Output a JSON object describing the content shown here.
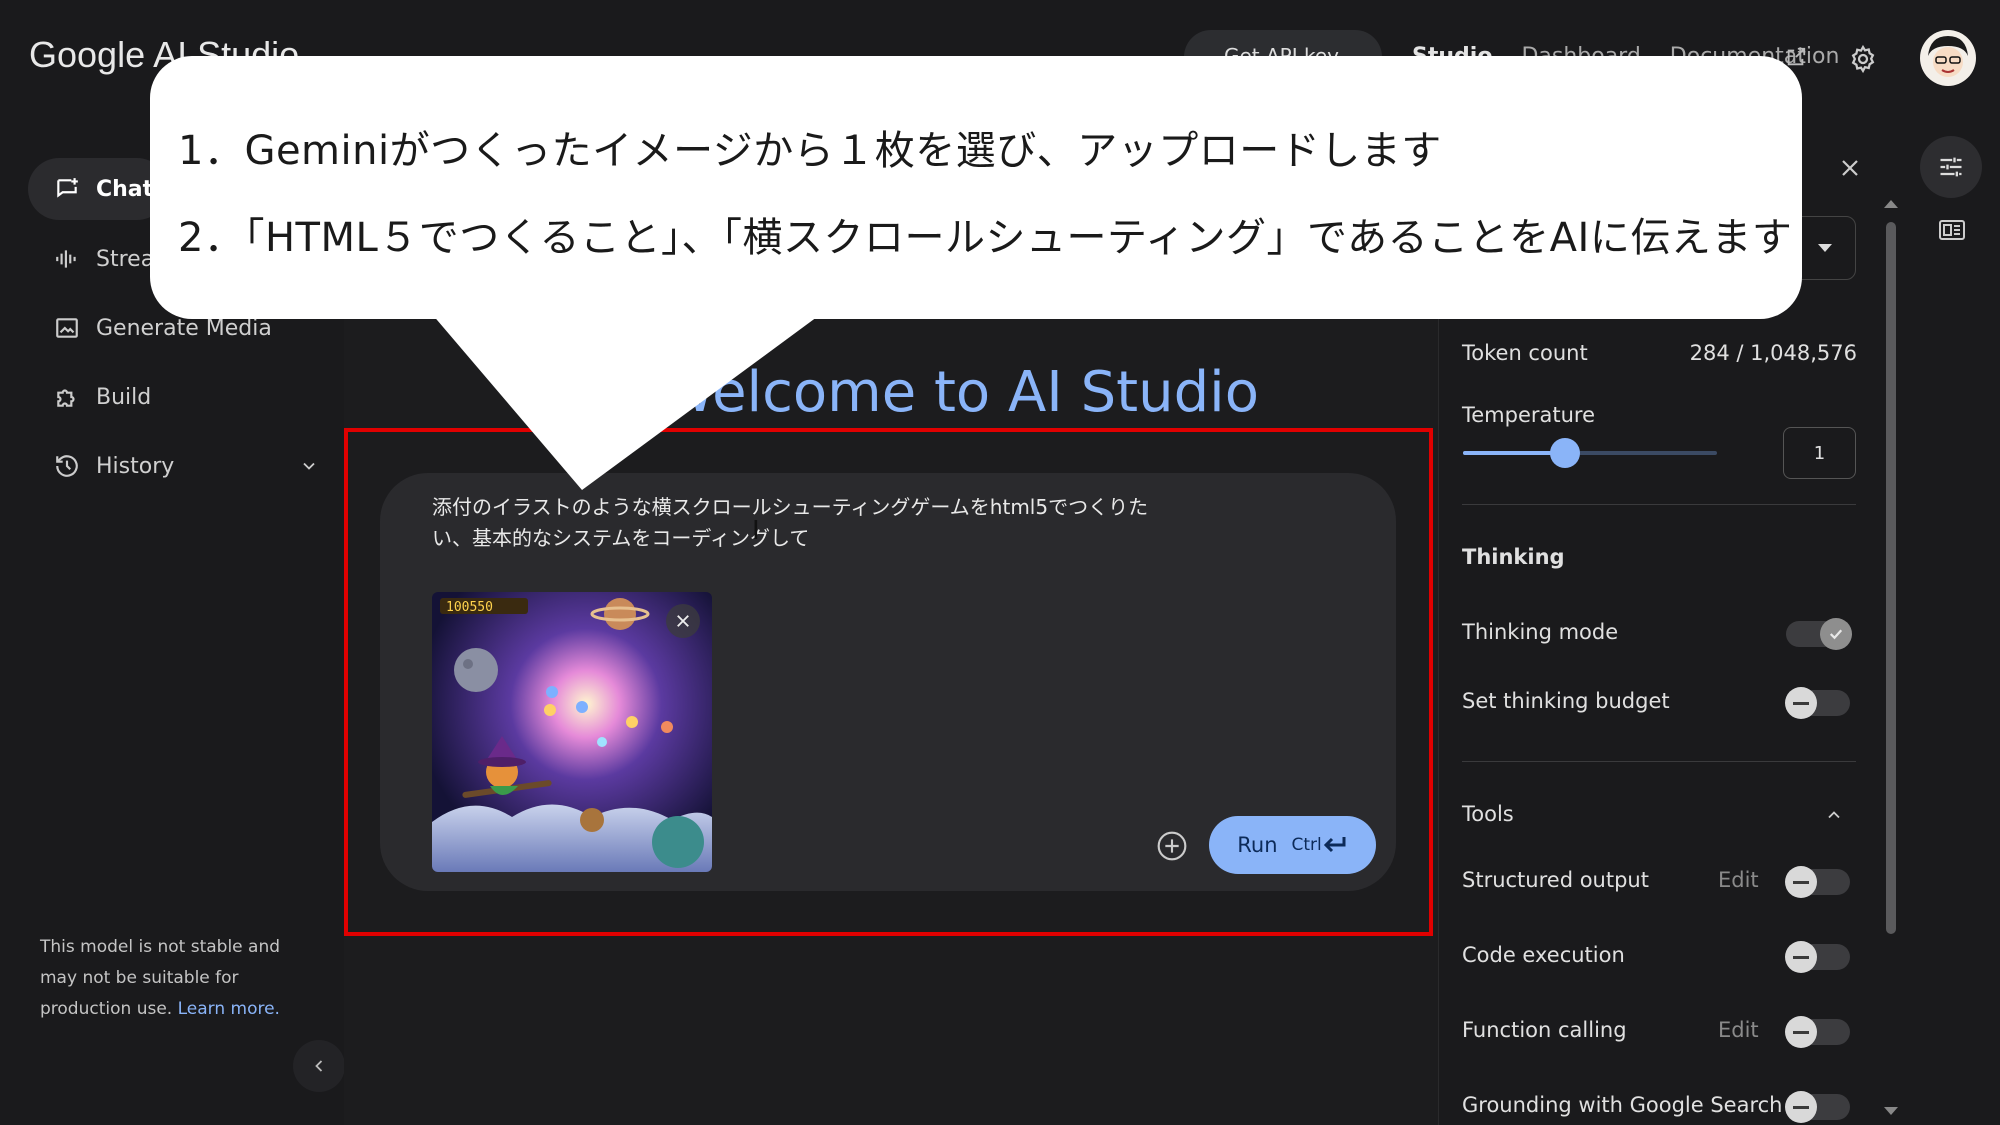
{
  "header": {
    "logo": "Google AI Studio",
    "get_api_key": "Get API key",
    "nav_studio": "Studio",
    "nav_dashboard": "Dashboard",
    "nav_docs": "Documentation"
  },
  "sidebar": {
    "items": [
      {
        "label": "Chat"
      },
      {
        "label": "Stream"
      },
      {
        "label": "Generate Media"
      },
      {
        "label": "Build"
      },
      {
        "label": "History"
      }
    ],
    "disclaimer": "This model is not stable and may not be suitable for production use.",
    "learn_more": "Learn more."
  },
  "main": {
    "welcome": "Welcome to AI Studio",
    "prompt_text": "添付のイラストのような横スクロールシューティングゲームをhtml5でつくりたい、基本的なシステムをコーディングして",
    "thumbnail_score": "100550",
    "run_label": "Run",
    "run_shortcut": "Ctrl"
  },
  "right_panel": {
    "token_count_label": "Token count",
    "token_count_value": "284 / 1,048,576",
    "temperature_label": "Temperature",
    "temperature_value": "1",
    "temperature_fraction": 0.4,
    "thinking_heading": "Thinking",
    "thinking_mode_label": "Thinking mode",
    "thinking_budget_label": "Set thinking budget",
    "tools_heading": "Tools",
    "structured_output_label": "Structured output",
    "code_execution_label": "Code execution",
    "function_calling_label": "Function calling",
    "grounding_label": "Grounding with Google Search",
    "edit_label": "Edit"
  },
  "callout": {
    "line1": "1．Geminiがつくったイメージから１枚を選び、アップロードします",
    "line2": "2．「HTML５でつくること」、「横スクロールシューティング」であることをAIに伝えます"
  },
  "colors": {
    "accent": "#8ab4f8",
    "highlight_border": "#e00000",
    "background": "#1a1a1c"
  }
}
